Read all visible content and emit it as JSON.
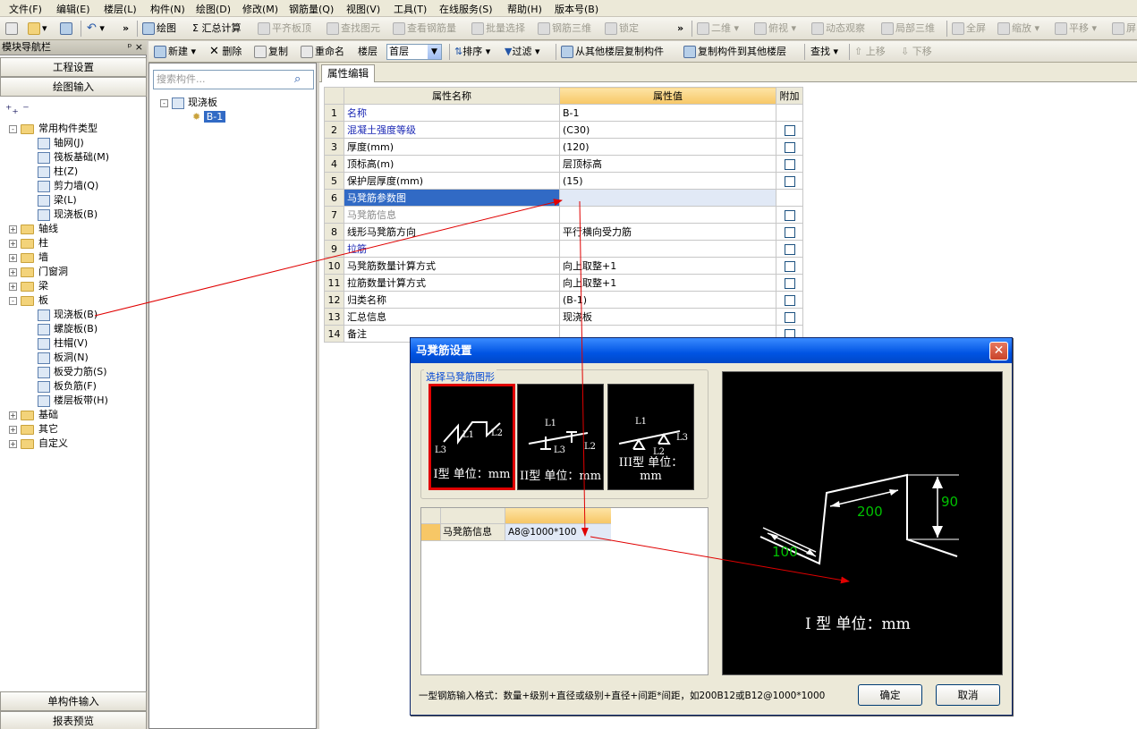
{
  "menubar": [
    "文件(F)",
    "编辑(E)",
    "楼层(L)",
    "构件(N)",
    "绘图(D)",
    "修改(M)",
    "钢筋量(Q)",
    "视图(V)",
    "工具(T)",
    "在线服务(S)",
    "帮助(H)",
    "版本号(B)"
  ],
  "toolbar1": {
    "draw": "绘图",
    "sum": "Σ 汇总计算",
    "flat": "平齐板顶",
    "find_elem": "查找图元",
    "view_rebar": "查看钢筋量",
    "batch": "批量选择",
    "rebar3d": "钢筋三维",
    "lock": "锁定",
    "view2d": "二维",
    "top_view": "俯视",
    "orbit": "动态观察",
    "local3d": "局部三维",
    "fullscreen": "全屏",
    "zoom": "缩放",
    "pan": "平移",
    "more": "屏"
  },
  "nav": {
    "title": "模块导航栏",
    "pin": "ᵖ ×",
    "btn_project": "工程设置",
    "btn_draw": "绘图输入",
    "btn_single": "单构件输入",
    "btn_report": "报表预览",
    "tree": [
      {
        "label": "常用构件类型",
        "level": 0,
        "type": "folder",
        "exp": "-"
      },
      {
        "label": "轴网(J)",
        "level": 1,
        "type": "item"
      },
      {
        "label": "筏板基础(M)",
        "level": 1,
        "type": "item"
      },
      {
        "label": "柱(Z)",
        "level": 1,
        "type": "item"
      },
      {
        "label": "剪力墙(Q)",
        "level": 1,
        "type": "item"
      },
      {
        "label": "梁(L)",
        "level": 1,
        "type": "item"
      },
      {
        "label": "现浇板(B)",
        "level": 1,
        "type": "item"
      },
      {
        "label": "轴线",
        "level": 0,
        "type": "folder",
        "exp": "+"
      },
      {
        "label": "柱",
        "level": 0,
        "type": "folder",
        "exp": "+"
      },
      {
        "label": "墙",
        "level": 0,
        "type": "folder",
        "exp": "+"
      },
      {
        "label": "门窗洞",
        "level": 0,
        "type": "folder",
        "exp": "+"
      },
      {
        "label": "梁",
        "level": 0,
        "type": "folder",
        "exp": "+"
      },
      {
        "label": "板",
        "level": 0,
        "type": "folder",
        "exp": "-"
      },
      {
        "label": "现浇板(B)",
        "level": 1,
        "type": "item"
      },
      {
        "label": "螺旋板(B)",
        "level": 1,
        "type": "item"
      },
      {
        "label": "柱帽(V)",
        "level": 1,
        "type": "item"
      },
      {
        "label": "板洞(N)",
        "level": 1,
        "type": "item"
      },
      {
        "label": "板受力筋(S)",
        "level": 1,
        "type": "item"
      },
      {
        "label": "板负筋(F)",
        "level": 1,
        "type": "item"
      },
      {
        "label": "楼层板带(H)",
        "level": 1,
        "type": "item"
      },
      {
        "label": "基础",
        "level": 0,
        "type": "folder",
        "exp": "+"
      },
      {
        "label": "其它",
        "level": 0,
        "type": "folder",
        "exp": "+"
      },
      {
        "label": "自定义",
        "level": 0,
        "type": "folder",
        "exp": "+"
      }
    ]
  },
  "toolbar2": {
    "new": "新建",
    "delete": "删除",
    "copy": "复制",
    "rename": "重命名",
    "floor_label": "楼层",
    "floor_value": "首层",
    "sort": "排序",
    "filter": "过滤",
    "copy_from": "从其他楼层复制构件",
    "copy_to": "复制构件到其他楼层",
    "find": "查找",
    "up": "上移",
    "down": "下移"
  },
  "list": {
    "search_placeholder": "搜索构件...",
    "root": "现浇板",
    "item": "B-1"
  },
  "prop": {
    "tab": "属性编辑",
    "col_name": "属性名称",
    "col_value": "属性值",
    "col_extra": "附加",
    "rows": [
      {
        "n": "1",
        "name": "名称",
        "value": "B-1",
        "style": "blue",
        "chk": false
      },
      {
        "n": "2",
        "name": "混凝土强度等级",
        "value": "(C30)",
        "style": "blue",
        "chk": true
      },
      {
        "n": "3",
        "name": "厚度(mm)",
        "value": "(120)",
        "style": "",
        "chk": true
      },
      {
        "n": "4",
        "name": "顶标高(m)",
        "value": "层顶标高",
        "style": "",
        "chk": true
      },
      {
        "n": "5",
        "name": "保护层厚度(mm)",
        "value": "(15)",
        "style": "",
        "chk": true
      },
      {
        "n": "6",
        "name": "马凳筋参数图",
        "value": "",
        "style": "sel",
        "chk": false
      },
      {
        "n": "7",
        "name": "马凳筋信息",
        "value": "",
        "style": "grey",
        "chk": true
      },
      {
        "n": "8",
        "name": "线形马凳筋方向",
        "value": "平行横向受力筋",
        "style": "",
        "chk": true
      },
      {
        "n": "9",
        "name": "拉筋",
        "value": "",
        "style": "blue",
        "chk": true
      },
      {
        "n": "10",
        "name": "马凳筋数量计算方式",
        "value": "向上取整+1",
        "style": "",
        "chk": true
      },
      {
        "n": "11",
        "name": "拉筋数量计算方式",
        "value": "向上取整+1",
        "style": "",
        "chk": true
      },
      {
        "n": "12",
        "name": "归类名称",
        "value": "(B-1)",
        "style": "",
        "chk": true
      },
      {
        "n": "13",
        "name": "汇总信息",
        "value": "现浇板",
        "style": "",
        "chk": true
      },
      {
        "n": "14",
        "name": "备注",
        "value": "",
        "style": "",
        "chk": true
      }
    ]
  },
  "dialog": {
    "title": "马凳筋设置",
    "group_title": "选择马凳筋图形",
    "shapes": [
      {
        "label": "I型 单位：mm"
      },
      {
        "label": "II型 单位：mm"
      },
      {
        "label": "III型 单位：mm"
      }
    ],
    "info_label": "马凳筋信息",
    "info_value": "A8@1000*100",
    "preview": {
      "dim_l1": "200",
      "dim_l2": "90",
      "dim_l3": "100",
      "label": "I 型  单位：mm"
    },
    "hint": "一型钢筋输入格式：数量+级别+直径或级别+直径+间距*间距，如200B12或B12@1000*1000",
    "ok": "确定",
    "cancel": "取消"
  },
  "colors": {
    "accent": "#316ac5",
    "title_bar": "#0054e3",
    "dim_green": "#00c000",
    "arrow": "#e00000"
  }
}
